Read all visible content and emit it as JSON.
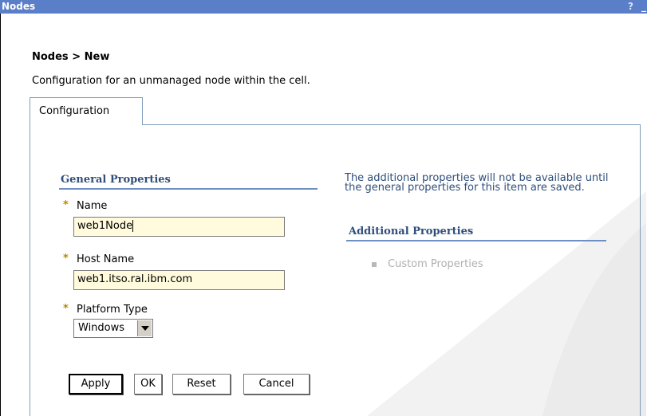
{
  "window": {
    "title": "Nodes",
    "help": "?",
    "minimize": "_"
  },
  "breadcrumb": "Nodes > New",
  "description": "Configuration for an unmanaged node within the cell.",
  "tab": {
    "label": "Configuration"
  },
  "general": {
    "heading": "General Properties",
    "required_marker": "*",
    "name_label": "Name",
    "name_value": "web1Node",
    "host_label": "Host Name",
    "host_value": "web1.itso.ral.ibm.com",
    "platform_label": "Platform Type",
    "platform_value": "Windows"
  },
  "buttons": {
    "apply": "Apply",
    "ok": "OK",
    "reset": "Reset",
    "cancel": "Cancel"
  },
  "additional": {
    "info": "The additional properties will not be available until the general properties for this item are saved.",
    "heading": "Additional Properties",
    "items": [
      "Custom Properties"
    ]
  },
  "colors": {
    "titlebar": "#5b7ec8",
    "heading": "#2f4e7a",
    "input_bg": "#fffbdc",
    "required": "#b48a00"
  }
}
